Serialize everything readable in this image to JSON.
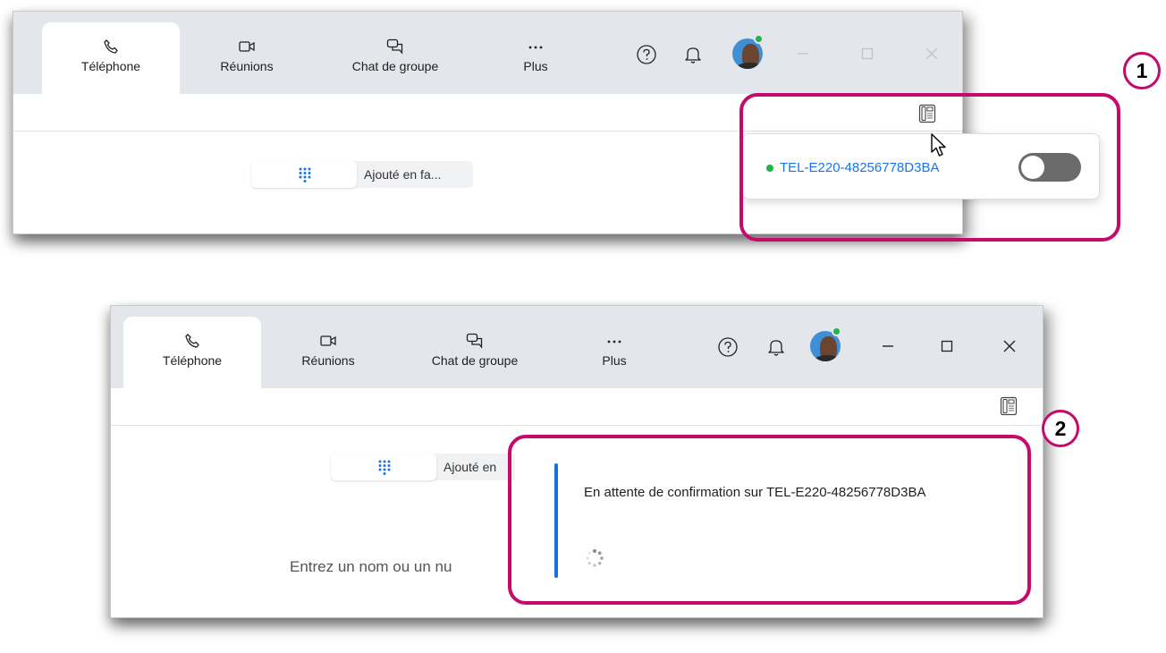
{
  "window_top": {
    "tabs": [
      {
        "label": "Téléphone",
        "icon": "phone-icon",
        "active": true
      },
      {
        "label": "Réunions",
        "icon": "video-icon"
      },
      {
        "label": "Chat de groupe",
        "icon": "chat-icon"
      },
      {
        "label": "Plus",
        "icon": "more-icon"
      }
    ],
    "dial_pill_text": "Ajouté en fa...",
    "device_popup": {
      "device_name": "TEL-E220-48256778D3BA",
      "status_color": "#1fb54a",
      "toggle_on": false
    }
  },
  "window_bottom": {
    "tabs": [
      {
        "label": "Téléphone",
        "icon": "phone-icon",
        "active": true
      },
      {
        "label": "Réunions",
        "icon": "video-icon"
      },
      {
        "label": "Chat de groupe",
        "icon": "chat-icon"
      },
      {
        "label": "Plus",
        "icon": "more-icon"
      }
    ],
    "dial_pill_text": "Ajouté en",
    "entry_prompt": "Entrez un nom ou un nu",
    "confirmation": {
      "message": "En attente de confirmation sur TEL-E220-48256778D3BA"
    }
  },
  "callouts": [
    {
      "number": "1",
      "color": "#c40a6b"
    },
    {
      "number": "2",
      "color": "#c40a6b"
    }
  ],
  "colors": {
    "accent": "#1a73e8",
    "callout": "#c40a6b",
    "presence": "#1fb54a",
    "tabbar": "#e3e6ea"
  }
}
